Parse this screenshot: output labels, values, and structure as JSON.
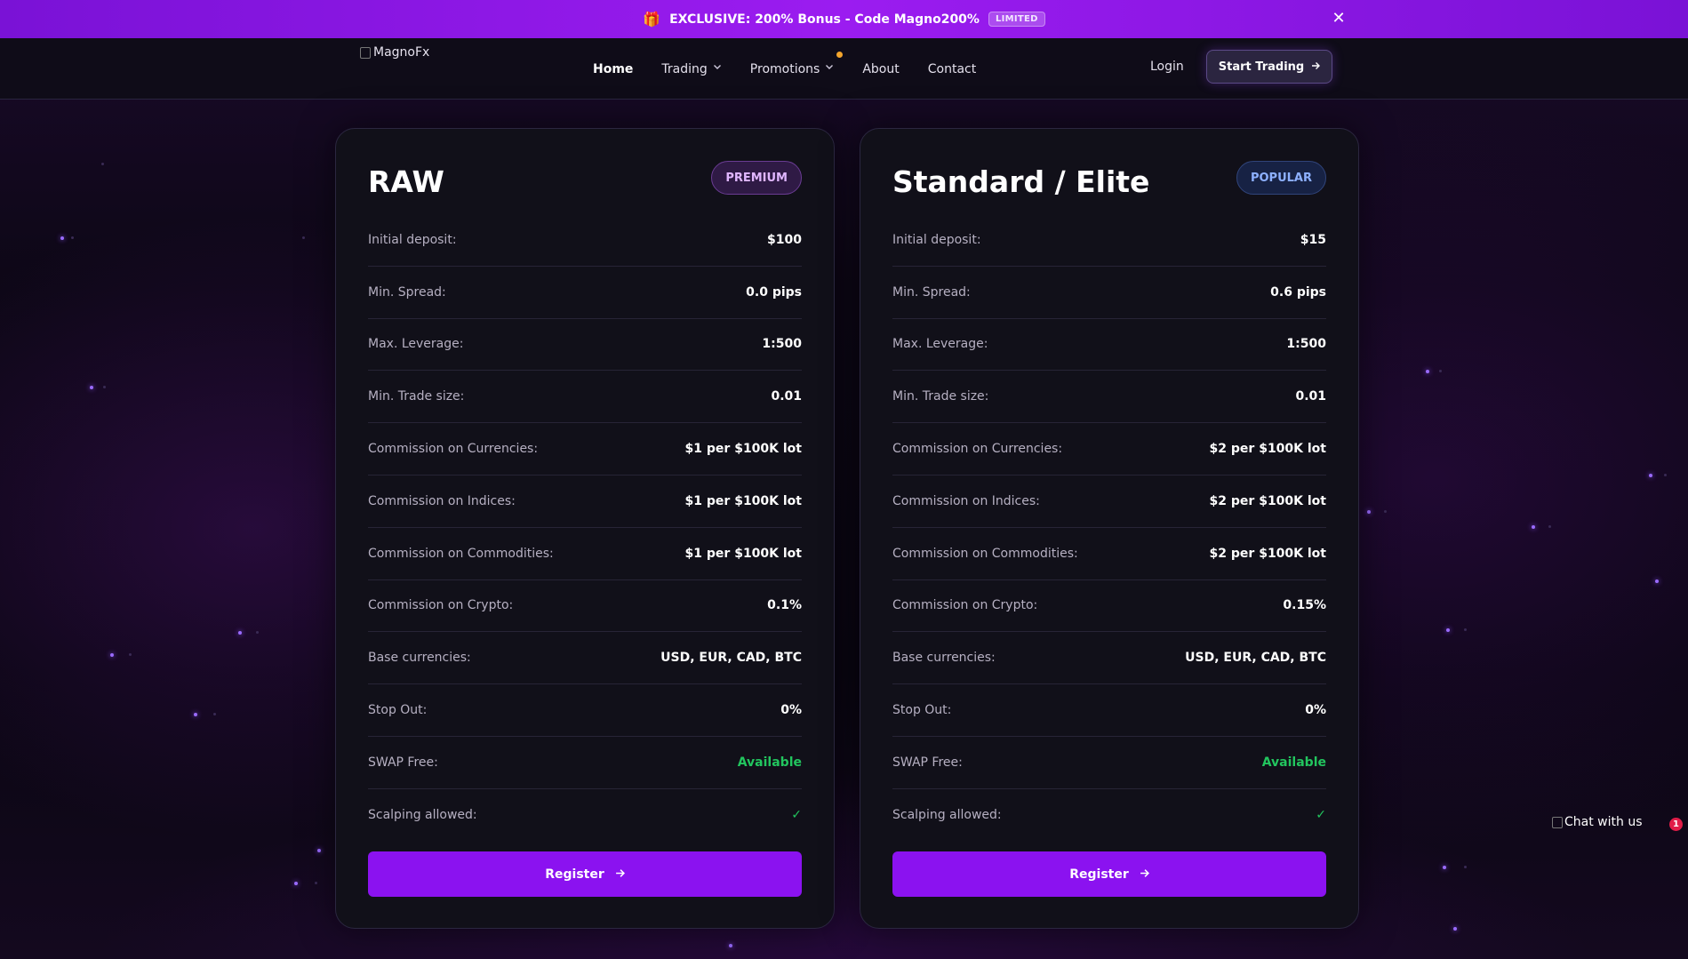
{
  "promo": {
    "icon": "gift-icon",
    "text": "EXCLUSIVE: 200% Bonus - Code Magno200%",
    "badge": "LIMITED",
    "close_icon": "close-icon"
  },
  "nav": {
    "logo_alt": "MagnoFx",
    "items": [
      {
        "label": "Home",
        "active": true
      },
      {
        "label": "Trading",
        "dropdown": true
      },
      {
        "label": "Promotions",
        "dropdown": true,
        "notification_dot": true
      },
      {
        "label": "About"
      },
      {
        "label": "Contact"
      }
    ],
    "login": "Login",
    "start_trading": "Start Trading"
  },
  "accounts": [
    {
      "title": "RAW",
      "tag": "PREMIUM",
      "rows": [
        {
          "label": "Initial deposit:",
          "value": "$100"
        },
        {
          "label": "Min. Spread:",
          "value": "0.0 pips"
        },
        {
          "label": "Max. Leverage:",
          "value": "1:500"
        },
        {
          "label": "Min. Trade size:",
          "value": "0.01"
        },
        {
          "label": "Commission on Currencies:",
          "value": "$1 per $100K lot"
        },
        {
          "label": "Commission on Indices:",
          "value": "$1 per $100K lot"
        },
        {
          "label": "Commission on Commodities:",
          "value": "$1 per $100K lot"
        },
        {
          "label": "Commission on Crypto:",
          "value": "0.1%"
        },
        {
          "label": "Base currencies:",
          "value": "USD, EUR, CAD, BTC"
        },
        {
          "label": "Stop Out:",
          "value": "0%"
        },
        {
          "label": "SWAP Free:",
          "value": "Available"
        },
        {
          "label": "Scalping allowed:",
          "value": "✓"
        }
      ],
      "register": "Register"
    },
    {
      "title": "Standard / Elite",
      "tag": "POPULAR",
      "rows": [
        {
          "label": "Initial deposit:",
          "value": "$15"
        },
        {
          "label": "Min. Spread:",
          "value": "0.6 pips"
        },
        {
          "label": "Max. Leverage:",
          "value": "1:500"
        },
        {
          "label": "Min. Trade size:",
          "value": "0.01"
        },
        {
          "label": "Commission on Currencies:",
          "value": "$2 per $100K lot"
        },
        {
          "label": "Commission on Indices:",
          "value": "$2 per $100K lot"
        },
        {
          "label": "Commission on Commodities:",
          "value": "$2 per $100K lot"
        },
        {
          "label": "Commission on Crypto:",
          "value": "0.15%"
        },
        {
          "label": "Base currencies:",
          "value": "USD, EUR, CAD, BTC"
        },
        {
          "label": "Stop Out:",
          "value": "0%"
        },
        {
          "label": "SWAP Free:",
          "value": "Available"
        },
        {
          "label": "Scalping allowed:",
          "value": "✓"
        }
      ],
      "register": "Register"
    }
  ],
  "chat": {
    "alt": "Chat with us",
    "unread_count": "1"
  },
  "colors": {
    "accent": "#8b12f0",
    "promo_bar": "#9b1cf0",
    "success": "#22c55e",
    "card_bg": "#111019",
    "notification": "#e11d48"
  }
}
